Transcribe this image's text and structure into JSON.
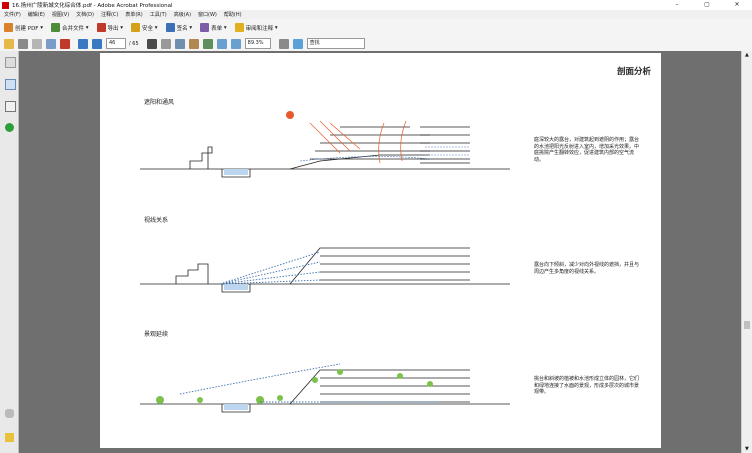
{
  "window": {
    "title": "16.扬州广陵新城文化综合体.pdf - Adobe Acrobat Professional"
  },
  "menu": [
    "文件(F)",
    "编辑(E)",
    "视图(V)",
    "文档(D)",
    "注释(C)",
    "表单(R)",
    "工具(T)",
    "高级(A)",
    "窗口(W)",
    "帮助(H)"
  ],
  "toolbar1": [
    {
      "label": "创建 PDF",
      "icon": "create-pdf-icon",
      "color": "#d9822b"
    },
    {
      "label": "合并文件",
      "icon": "combine-icon",
      "color": "#4c8c3a"
    },
    {
      "label": "导出",
      "icon": "export-icon",
      "color": "#c0392b"
    },
    {
      "label": "安全",
      "icon": "lock-icon",
      "color": "#d4a017"
    },
    {
      "label": "签名",
      "icon": "pen-icon",
      "color": "#3b6fb6"
    },
    {
      "label": "表单",
      "icon": "form-icon",
      "color": "#7b5ea7"
    },
    {
      "label": "审阅和注释",
      "icon": "comment-icon",
      "color": "#e0b020"
    }
  ],
  "nav": {
    "page": "46",
    "total": "/ 65",
    "zoom": "89.3%",
    "find_placeholder": "查找"
  },
  "page": {
    "heading": "剖面分析",
    "sections": [
      {
        "title": "遮阳和通风",
        "text": "庭深较大的露台，对建筑起到遮阴的作用；露台的水池把阳光反射进入室内，增加采光效果。中庭挑院产生翻转效应，促进建筑内部的空气流动。"
      },
      {
        "title": "视线关系",
        "text": "露台向下倾斜，减少对向外视线的遮挡，并且与周边产生多角度的视线关系。"
      },
      {
        "title": "景观延续",
        "text": "挑台和斜坡的植被和水池形成立体的园林，它们和绿地连接了水面的景观，形成多层次的城市景观带。"
      }
    ]
  }
}
